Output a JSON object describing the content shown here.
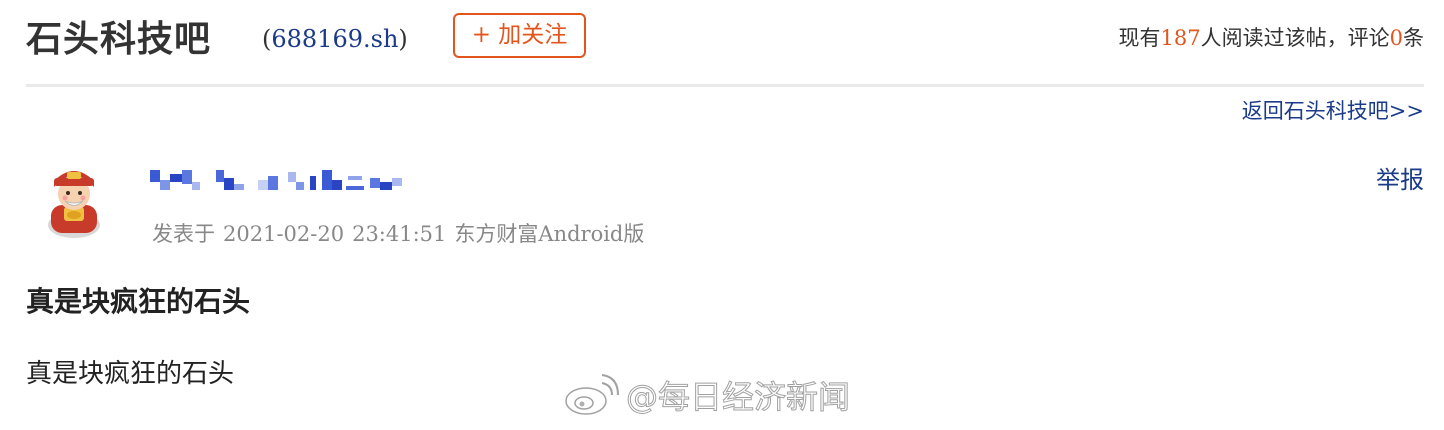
{
  "header": {
    "bar_title": "石头科技吧",
    "stock_code_open": "(",
    "stock_code": "688169.sh",
    "stock_code_close": ")",
    "follow_label": "+ 加关注",
    "stats": {
      "prefix": "现有",
      "read_count": "187",
      "middle": "人阅读过该帖，评论",
      "comment_count": "0",
      "suffix": "条"
    }
  },
  "nav": {
    "back_label": "返回石头科技吧>>"
  },
  "post": {
    "username": "",
    "report_label": "举报",
    "meta": {
      "prefix": "发表于",
      "date": "2021-02-20",
      "time": "23:41:51",
      "source": "东方财富Android版"
    },
    "title": "真是块疯狂的石头",
    "body": "真是块疯狂的石头"
  },
  "watermark": {
    "text": "@每日经济新闻",
    "icon": "weibo-icon"
  },
  "colors": {
    "accent_orange": "#e2561e",
    "link_blue": "#1a3a8a",
    "meta_gray": "#888888",
    "text_dark": "#333333"
  }
}
